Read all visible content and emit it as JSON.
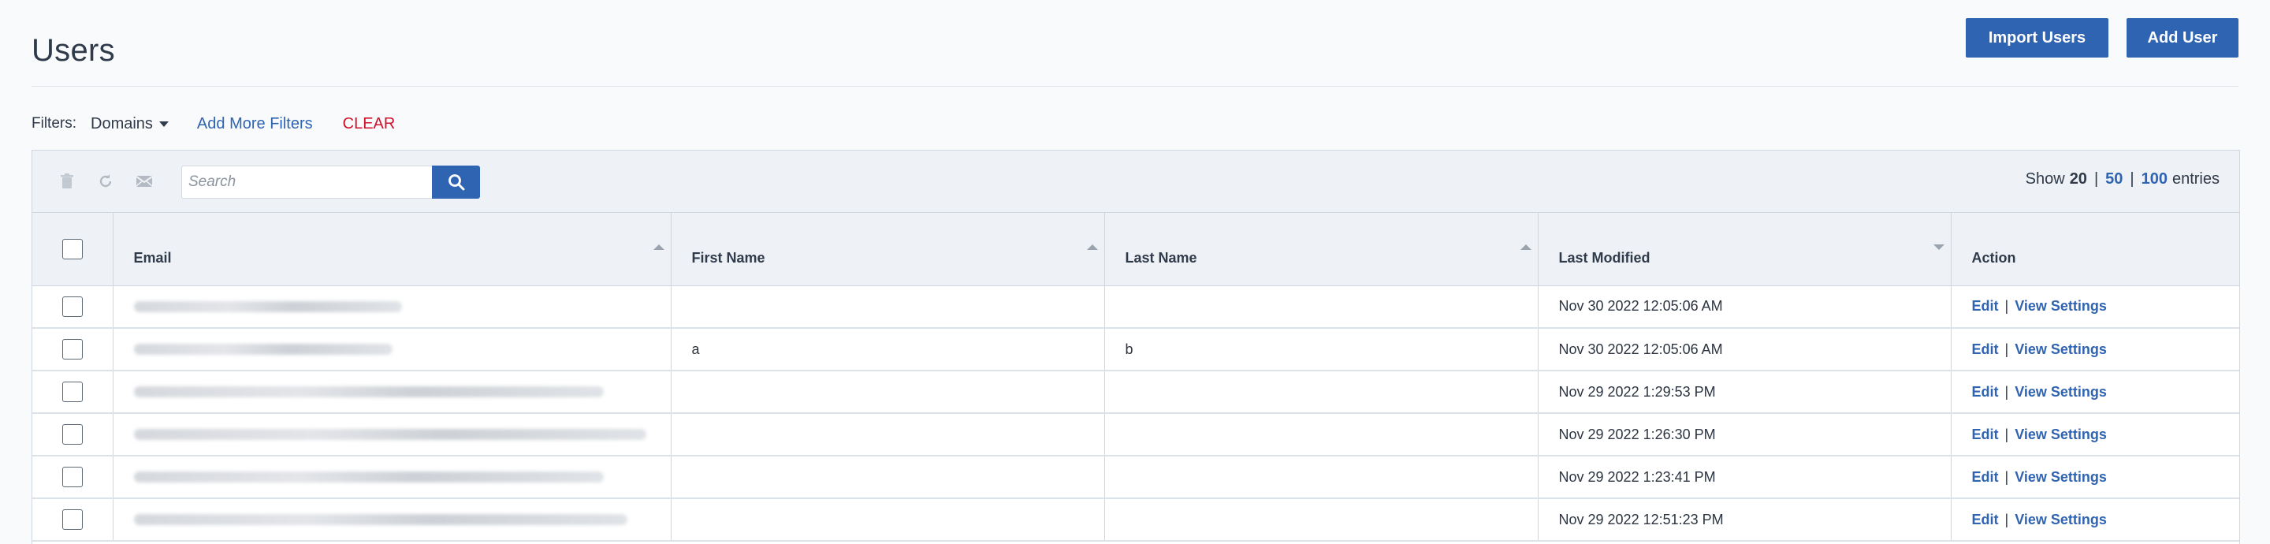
{
  "header": {
    "title": "Users",
    "import_label": "Import Users",
    "add_label": "Add User"
  },
  "filters": {
    "label": "Filters:",
    "domains_label": "Domains",
    "add_more_label": "Add More Filters",
    "clear_label": "CLEAR"
  },
  "toolbar": {
    "icons": [
      "trash-icon",
      "refresh-icon",
      "email-icon",
      "search-icon"
    ],
    "search_placeholder": "Search",
    "show_label": "Show",
    "entries_label": "entries",
    "page_sizes": [
      "20",
      "50",
      "100"
    ],
    "active_page_size": "20",
    "separator": "|"
  },
  "table": {
    "columns": {
      "email": "Email",
      "first_name": "First Name",
      "last_name": "Last Name",
      "last_modified": "Last Modified",
      "action": "Action"
    },
    "rows": [
      {
        "first_name": "",
        "last_name": "",
        "last_modified": "Nov 30 2022 12:05:06 AM"
      },
      {
        "first_name": "a",
        "last_name": "b",
        "last_modified": "Nov 30 2022 12:05:06 AM"
      },
      {
        "first_name": "",
        "last_name": "",
        "last_modified": "Nov 29 2022 1:29:53 PM"
      },
      {
        "first_name": "",
        "last_name": "",
        "last_modified": "Nov 29 2022 1:26:30 PM"
      },
      {
        "first_name": "",
        "last_name": "",
        "last_modified": "Nov 29 2022 1:23:41 PM"
      },
      {
        "first_name": "",
        "last_name": "",
        "last_modified": "Nov 29 2022 12:51:23 PM"
      }
    ],
    "action_edit": "Edit",
    "action_separator": "|",
    "action_view": "View Settings"
  },
  "colors": {
    "primary": "#2f64b2",
    "danger": "#d0112b",
    "header_bg": "#eef1f5",
    "page_bg": "#f9fafb"
  }
}
